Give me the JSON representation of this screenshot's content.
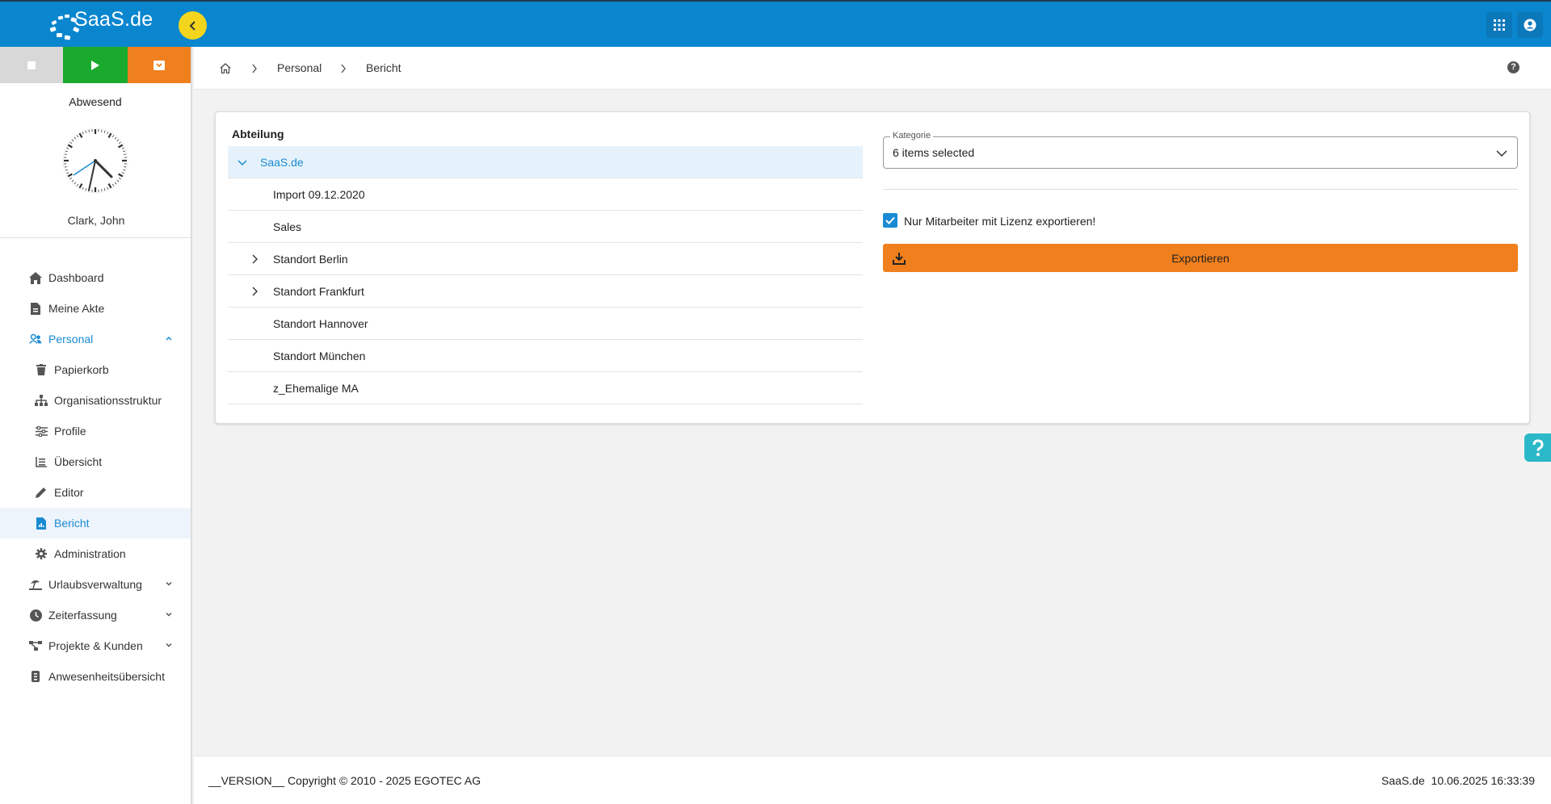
{
  "app": {
    "logo_text": "SaaS.de",
    "colors": {
      "topbar": "#0a86cf",
      "accent": "#1a8bd3",
      "orange": "#f07f1d",
      "green": "#1aaa2e",
      "yellow": "#f4d51d"
    }
  },
  "topbar": {
    "collapse_icon": "chevron-left-icon",
    "apps_icon": "apps-grid-icon",
    "account_icon": "account-circle-icon"
  },
  "sidebar": {
    "state_buttons": [
      "stop-icon",
      "play-icon",
      "pause-icon"
    ],
    "status": "Abwesend",
    "user_name": "Clark, John",
    "nav": [
      {
        "label": "Dashboard",
        "icon": "home-icon"
      },
      {
        "label": "Meine Akte",
        "icon": "file-icon"
      },
      {
        "label": "Personal",
        "icon": "people-icon",
        "active": true,
        "expanded": true
      },
      {
        "label": "Papierkorb",
        "icon": "trash-icon",
        "sub": true
      },
      {
        "label": "Organisationsstruktur",
        "icon": "org-chart-icon",
        "sub": true
      },
      {
        "label": "Profile",
        "icon": "sliders-icon",
        "sub": true
      },
      {
        "label": "Übersicht",
        "icon": "list-icon",
        "sub": true
      },
      {
        "label": "Editor",
        "icon": "pencil-icon",
        "sub": true
      },
      {
        "label": "Bericht",
        "icon": "report-icon",
        "sub": true,
        "active": true
      },
      {
        "label": "Administration",
        "icon": "gear-icon",
        "sub": true
      },
      {
        "label": "Urlaubsverwaltung",
        "icon": "beach-icon"
      },
      {
        "label": "Zeiterfassung",
        "icon": "clock-icon"
      },
      {
        "label": "Projekte & Kunden",
        "icon": "nodes-icon"
      },
      {
        "label": "Anwesenheitsübersicht",
        "icon": "badge-icon"
      }
    ]
  },
  "breadcrumb": {
    "items": [
      "Personal",
      "Bericht"
    ],
    "home_icon": "home-outline-icon",
    "help_icon": "help-icon"
  },
  "report": {
    "dept_title": "Abteilung",
    "tree": [
      {
        "label": "SaaS.de",
        "root": true
      },
      {
        "label": "Import 09.12.2020"
      },
      {
        "label": "Sales"
      },
      {
        "label": "Standort Berlin",
        "expandable": true
      },
      {
        "label": "Standort Frankfurt",
        "expandable": true
      },
      {
        "label": "Standort Hannover"
      },
      {
        "label": "Standort München"
      },
      {
        "label": "z_Ehemalige MA"
      }
    ],
    "kategorie_label": "Kategorie",
    "kategorie_value": "6 items selected",
    "checkbox_label": "Nur Mitarbeiter mit Lizenz exportieren!",
    "checkbox_checked": true,
    "export_label": "Exportieren"
  },
  "footer": {
    "left": "__VERSION__ Copyright © 2010 - 2025 EGOTEC AG",
    "right": "SaaS.de  10.06.2025 16:33:39"
  }
}
